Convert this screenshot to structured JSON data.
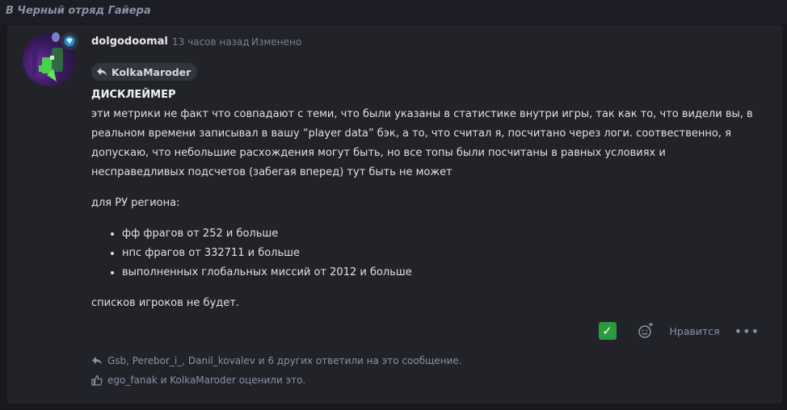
{
  "breadcrumb": "В Черный отряд Гайера",
  "post": {
    "author": "dolgodoomal",
    "time": "13 часов назад",
    "edited": "Изменено",
    "reply_to": "KolkaMaroder",
    "heading": "ДИСКЛЕЙМЕР",
    "paragraph1": "эти метрики не факт что совпадают с теми, что были указаны в статистике внутри игры, так как то, что видели вы, в реальном времени записывал в вашу “player data” бэк, а то, что считал я, посчитано через логи. соотвественно, я допускаю, что небольшие расхождения могут быть, но все топы были посчитаны в равных условиях и несправедливых подсчетов (забегая вперед) тут быть не может",
    "region_label": "для РУ региона:",
    "bullets": [
      "фф фрагов от 252 и больше",
      "нпс фрагов от 332711 и больше",
      "выполненных глобальных миссий от 2012 и больше"
    ],
    "closing": "списков игроков не будет.",
    "actions": {
      "like_label": "Нравится",
      "more_label": "•••"
    },
    "replies_text": "Gsb, Perebor_i_, Danil_kovalev и 6 других ответили на это сообщение.",
    "likes_text": "ego_fanak и KolkaMaroder оценили это."
  },
  "colors": {
    "background": "#18191f",
    "card": "#222329",
    "accent_check": "#2b9a3f",
    "muted_text": "#8c8fa6"
  },
  "icons": {
    "reply": "reply-arrow-icon",
    "react": "add-reaction-icon",
    "check": "check-mark-icon",
    "thumb": "thumbs-up-icon",
    "badge": "diamond-badge-icon"
  }
}
